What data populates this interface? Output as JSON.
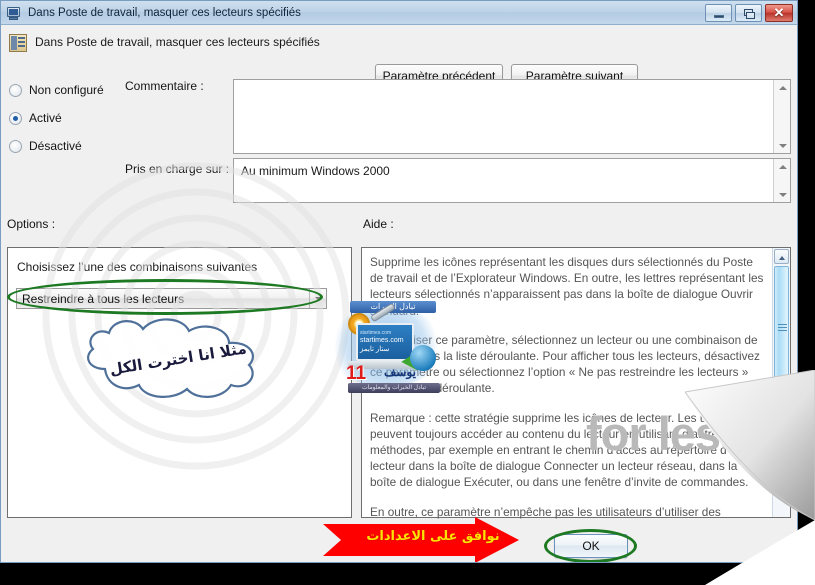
{
  "window": {
    "title": "Dans Poste de travail, masquer ces lecteurs spécifiés",
    "icon": "policy-window-icon",
    "controls": {
      "minimize": "minimize-icon",
      "restore": "restore-icon",
      "close": "✕"
    }
  },
  "header": {
    "icon": "policy-setting-icon",
    "title": "Dans Poste de travail, masquer ces lecteurs spécifiés",
    "prev_button": "Paramètre précédent",
    "next_button": "Paramètre suivant"
  },
  "state": {
    "options": [
      {
        "label": "Non configuré",
        "selected": false
      },
      {
        "label": "Activé",
        "selected": true
      },
      {
        "label": "Désactivé",
        "selected": false
      }
    ]
  },
  "comment": {
    "label": "Commentaire :",
    "value": ""
  },
  "support": {
    "label": "Pris en charge sur :",
    "value": "Au minimum Windows 2000"
  },
  "options_panel": {
    "label": "Options :",
    "instruction": "Choisissez l’une des combinaisons suivantes",
    "combo_value": "Restreindre à tous les lecteurs"
  },
  "help_panel": {
    "label": "Aide :",
    "paragraphs": [
      "Supprime les icônes représentant les disques durs sélectionnés du Poste de travail et de l’Explorateur Windows. En outre, les lettres représentant les lecteurs sélectionnés n’apparaissent pas dans la boîte de dialogue Ouvrir standard.",
      "Pour utiliser ce paramètre, sélectionnez un lecteur ou une combinaison de lecteurs dans la liste déroulante. Pour afficher tous les lecteurs, désactivez ce paramètre ou sélectionnez l’option « Ne pas restreindre les lecteurs » dans la liste déroulante.",
      "Remarque : cette stratégie supprime les icônes de lecteur. Les utilisateurs peuvent toujours accéder au contenu du lecteur en utilisant d’autres méthodes, par exemple en entrant le chemin d’accès au répertoire d’un lecteur dans la boîte de dialogue Connecter un lecteur réseau, dans la boîte de dialogue Exécuter, ou dans une fenêtre d’invite de commandes.",
      "En outre, ce paramètre n’empêche pas les utilisateurs d’utiliser des programmes"
    ]
  },
  "footer": {
    "ok_button": "OK"
  },
  "annotations": {
    "cloud_text": "مثلا انا اخترت الكل",
    "arrow_text": "نوافق على الاعدادات",
    "ellipse_color": "#1d7a23",
    "arrow_color": "#ff0000",
    "arrow_text_color": "#ffe400",
    "cloud_text_color": "#1a1a3c"
  },
  "watermark": {
    "for_less": "for less!",
    "logo_banner_top": "تبادل الخبرات",
    "logo_line1": "startimes.com",
    "logo_line2": "startimes.com",
    "logo_line3": "ستار تايمز",
    "logo_red": "11",
    "logo_blue": "يوسف",
    "logo_banner_bottom": "تبادل الخبرات والمعلومات"
  }
}
